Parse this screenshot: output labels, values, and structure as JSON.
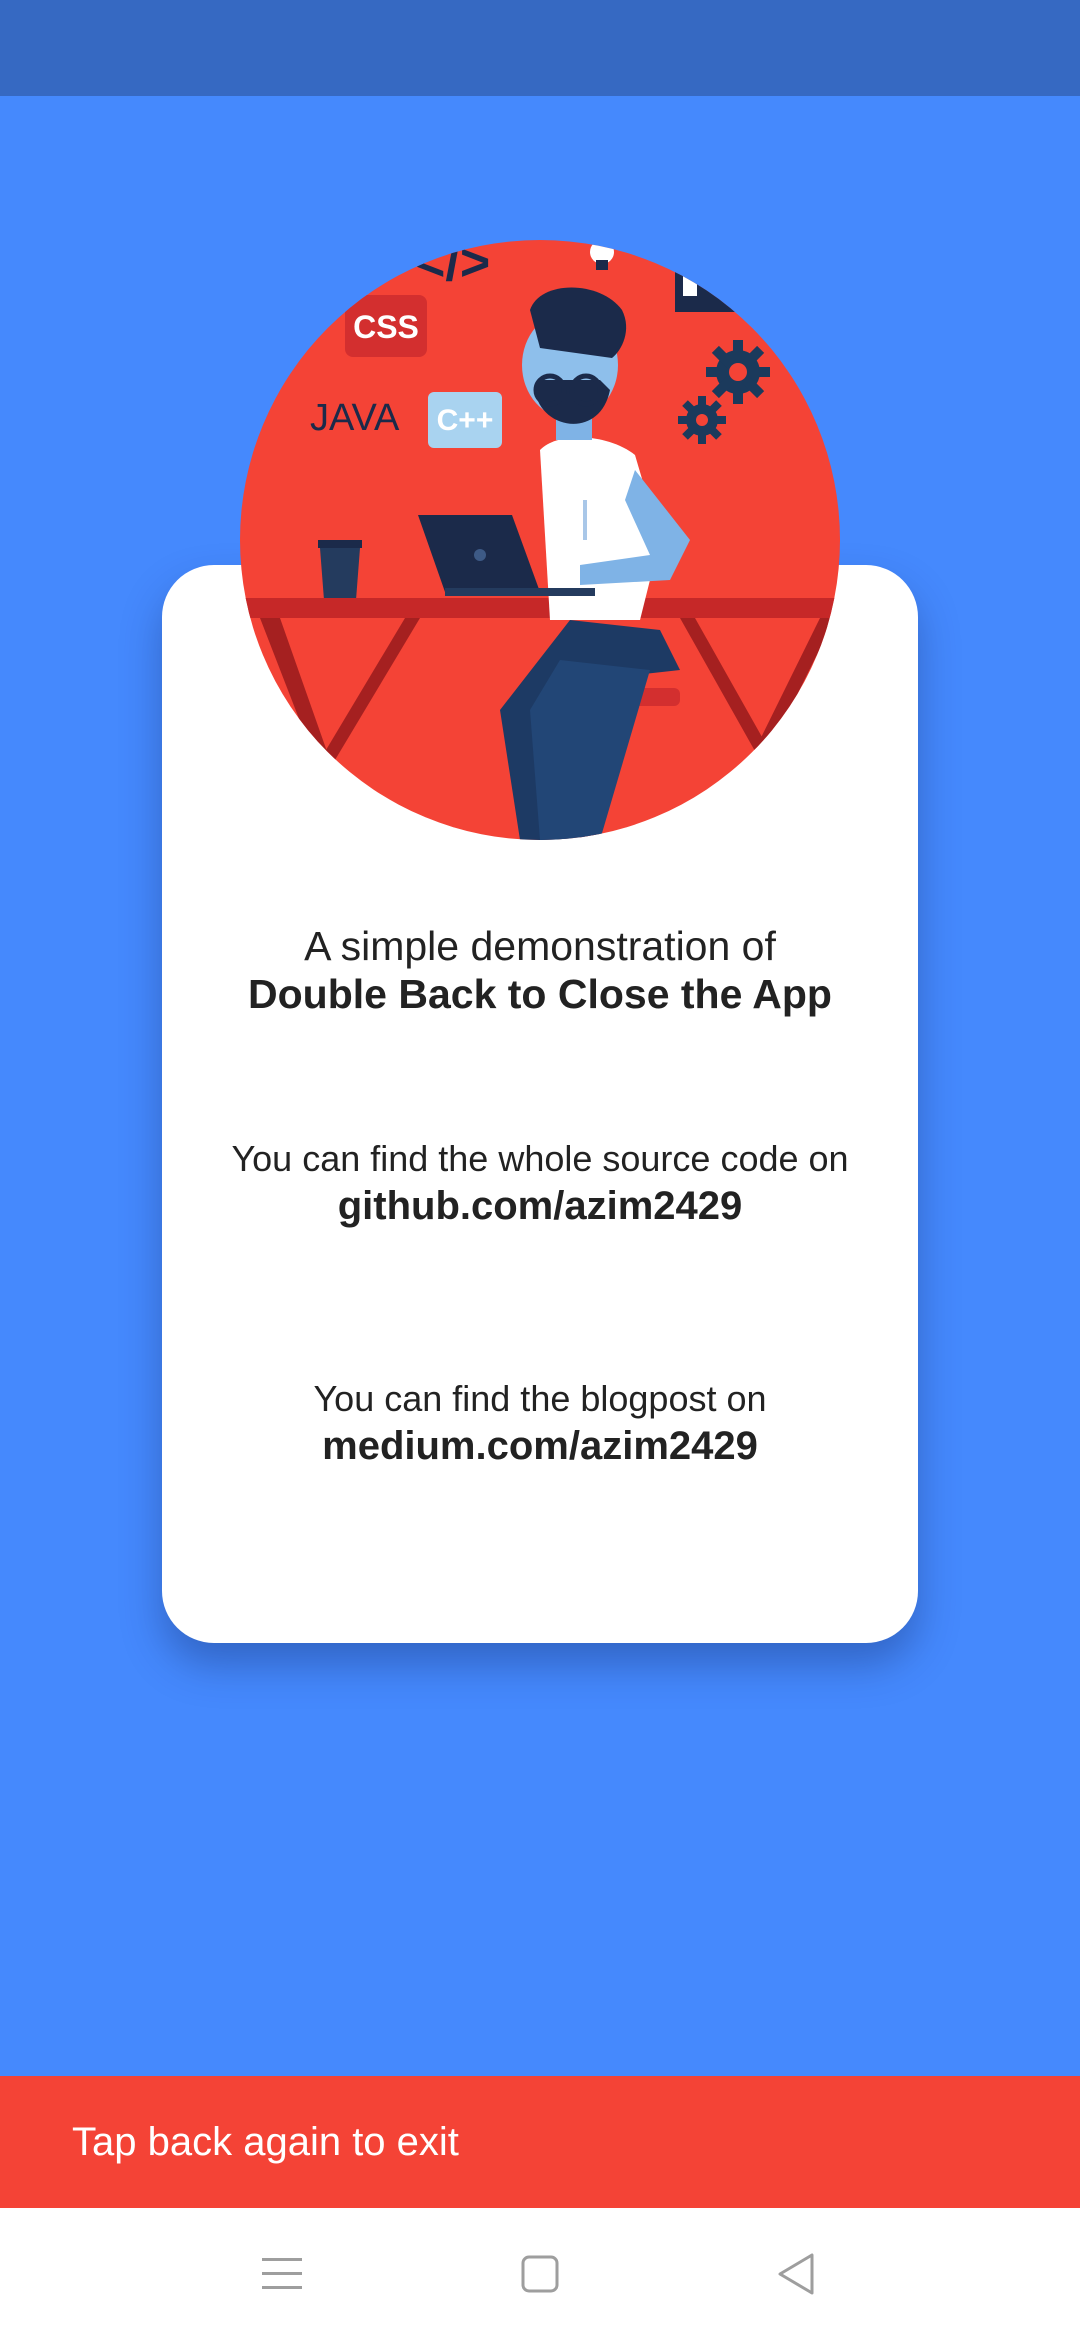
{
  "card": {
    "intro_line": "A simple demonstration of",
    "intro_bold": "Double Back to Close the App",
    "source_line": "You can find the whole source code on",
    "source_link": "github.com/azim2429",
    "blog_line": "You can find the blogpost on",
    "blog_link": "medium.com/azim2429"
  },
  "illustration": {
    "labels": {
      "css": "CSS",
      "java": "JAVA",
      "cpp": "C++",
      "code": "</>"
    }
  },
  "snackbar": {
    "message": "Tap back again to exit"
  },
  "icons": {
    "nav_menu": "menu-icon",
    "nav_home": "home-square-icon",
    "nav_back": "back-triangle-icon"
  },
  "colors": {
    "status_bar": "#3669c2",
    "background": "#4589fd",
    "card": "#ffffff",
    "snackbar": "#f44336",
    "illustration_bg": "#f44336"
  }
}
